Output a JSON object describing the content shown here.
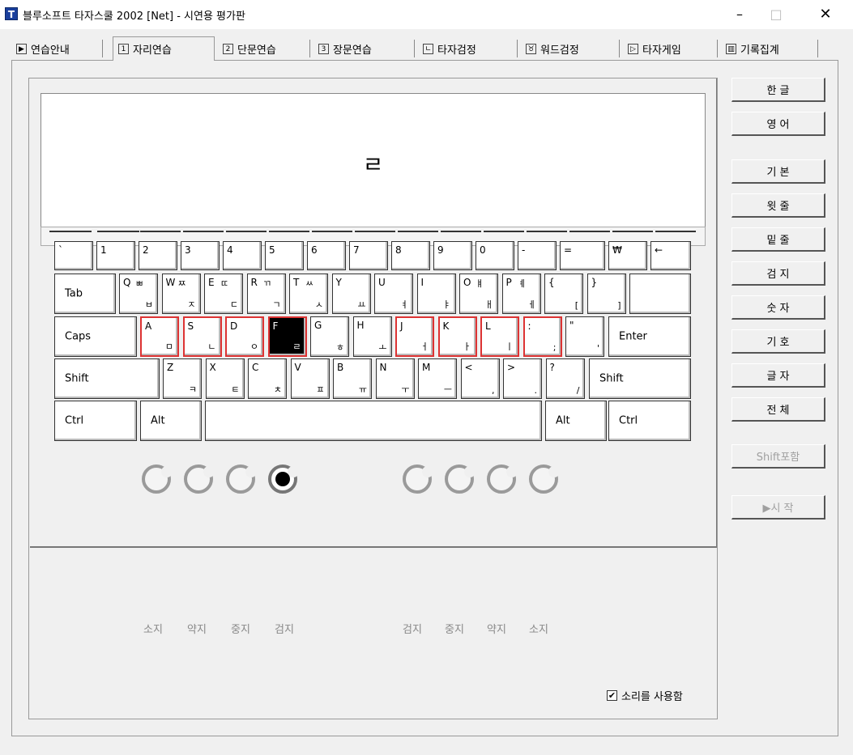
{
  "window": {
    "icon_letter": "T",
    "title": "블루소프트 타자스쿨 2002 [Net] - 시연용 평가판",
    "min": "–",
    "max": "□",
    "close": "✕"
  },
  "tabs": [
    {
      "icon": "▶",
      "label": "연습안내",
      "active": false
    },
    {
      "icon": "1",
      "label": "자리연습",
      "active": true
    },
    {
      "icon": "2",
      "label": "단문연습",
      "active": false
    },
    {
      "icon": "3",
      "label": "장문연습",
      "active": false
    },
    {
      "icon": "ㄴ",
      "label": "타자검정",
      "active": false
    },
    {
      "icon": "♉",
      "label": "워드검정",
      "active": false
    },
    {
      "icon": "▷",
      "label": "타자게임",
      "active": false
    },
    {
      "icon": "▥",
      "label": "기록집계",
      "active": false
    }
  ],
  "display": {
    "target_char": "ㄹ"
  },
  "keyboard": {
    "row1": [
      {
        "u": "`",
        "l": ""
      },
      {
        "u": "1",
        "l": ""
      },
      {
        "u": "2",
        "l": ""
      },
      {
        "u": "3",
        "l": ""
      },
      {
        "u": "4",
        "l": ""
      },
      {
        "u": "5",
        "l": ""
      },
      {
        "u": "6",
        "l": ""
      },
      {
        "u": "7",
        "l": ""
      },
      {
        "u": "8",
        "l": ""
      },
      {
        "u": "9",
        "l": ""
      },
      {
        "u": "0",
        "l": ""
      },
      {
        "u": "-",
        "l": ""
      },
      {
        "u": "=",
        "l": ""
      },
      {
        "u": "₩",
        "l": ""
      },
      {
        "u": "←",
        "l": ""
      }
    ],
    "row2": [
      {
        "u": "Q",
        "hu": "ㅃ",
        "l": "ㅂ"
      },
      {
        "u": "W",
        "hu": "ㅉ",
        "l": "ㅈ"
      },
      {
        "u": "E",
        "hu": "ㄸ",
        "l": "ㄷ"
      },
      {
        "u": "R",
        "hu": "ㄲ",
        "l": "ㄱ"
      },
      {
        "u": "T",
        "hu": "ㅆ",
        "l": "ㅅ"
      },
      {
        "u": "Y",
        "hu": "",
        "l": "ㅛ"
      },
      {
        "u": "U",
        "hu": "",
        "l": "ㅕ"
      },
      {
        "u": "I",
        "hu": "",
        "l": "ㅑ"
      },
      {
        "u": "O",
        "hu": "ㅒ",
        "l": "ㅐ"
      },
      {
        "u": "P",
        "hu": "ㅖ",
        "l": "ㅔ"
      },
      {
        "u": "{",
        "hu": "",
        "l": "["
      },
      {
        "u": "}",
        "hu": "",
        "l": "]"
      }
    ],
    "row3": [
      {
        "u": "A",
        "l": "ㅁ"
      },
      {
        "u": "S",
        "l": "ㄴ"
      },
      {
        "u": "D",
        "l": "ㅇ"
      },
      {
        "u": "F",
        "l": "ㄹ"
      },
      {
        "u": "G",
        "l": "ㅎ"
      },
      {
        "u": "H",
        "l": "ㅗ"
      },
      {
        "u": "J",
        "l": "ㅓ"
      },
      {
        "u": "K",
        "l": "ㅏ"
      },
      {
        "u": "L",
        "l": "ㅣ"
      },
      {
        "u": ":",
        "l": ";"
      },
      {
        "u": "\"",
        "l": "'"
      }
    ],
    "row4": [
      {
        "u": "Z",
        "l": "ㅋ"
      },
      {
        "u": "X",
        "l": "ㅌ"
      },
      {
        "u": "C",
        "l": "ㅊ"
      },
      {
        "u": "V",
        "l": "ㅍ"
      },
      {
        "u": "B",
        "l": "ㅠ"
      },
      {
        "u": "N",
        "l": "ㅜ"
      },
      {
        "u": "M",
        "l": "ㅡ"
      },
      {
        "u": "<",
        "l": ","
      },
      {
        "u": ">",
        "l": "."
      },
      {
        "u": "?",
        "l": "/"
      }
    ],
    "tab": "Tab",
    "caps": "Caps",
    "enter": "Enter",
    "shift_l": "Shift",
    "shift_r": "Shift",
    "ctrl_l": "Ctrl",
    "alt_l": "Alt",
    "alt_r": "Alt",
    "ctrl_r": "Ctrl",
    "active_key": "F",
    "home_keys": [
      "A",
      "S",
      "D",
      "J",
      "K",
      "L",
      ":"
    ]
  },
  "finger_labels": {
    "left": [
      "소지",
      "약지",
      "중지",
      "검지"
    ],
    "right": [
      "검지",
      "중지",
      "약지",
      "소지"
    ]
  },
  "active_finger": "left-index",
  "sound": {
    "label": "소리를 사용함",
    "checked": true
  },
  "side_buttons": [
    {
      "label": "한 글",
      "enabled": true
    },
    {
      "label": "영 어",
      "enabled": true
    },
    {
      "label": "기 본",
      "enabled": true
    },
    {
      "label": "윗 줄",
      "enabled": true
    },
    {
      "label": "밑 줄",
      "enabled": true
    },
    {
      "label": "검 지",
      "enabled": true
    },
    {
      "label": "숫 자",
      "enabled": true
    },
    {
      "label": "기 호",
      "enabled": true
    },
    {
      "label": "글 자",
      "enabled": true
    },
    {
      "label": "전 체",
      "enabled": true
    },
    {
      "label": "Shift포함",
      "enabled": false
    },
    {
      "label": "▶시 작",
      "enabled": false
    }
  ]
}
